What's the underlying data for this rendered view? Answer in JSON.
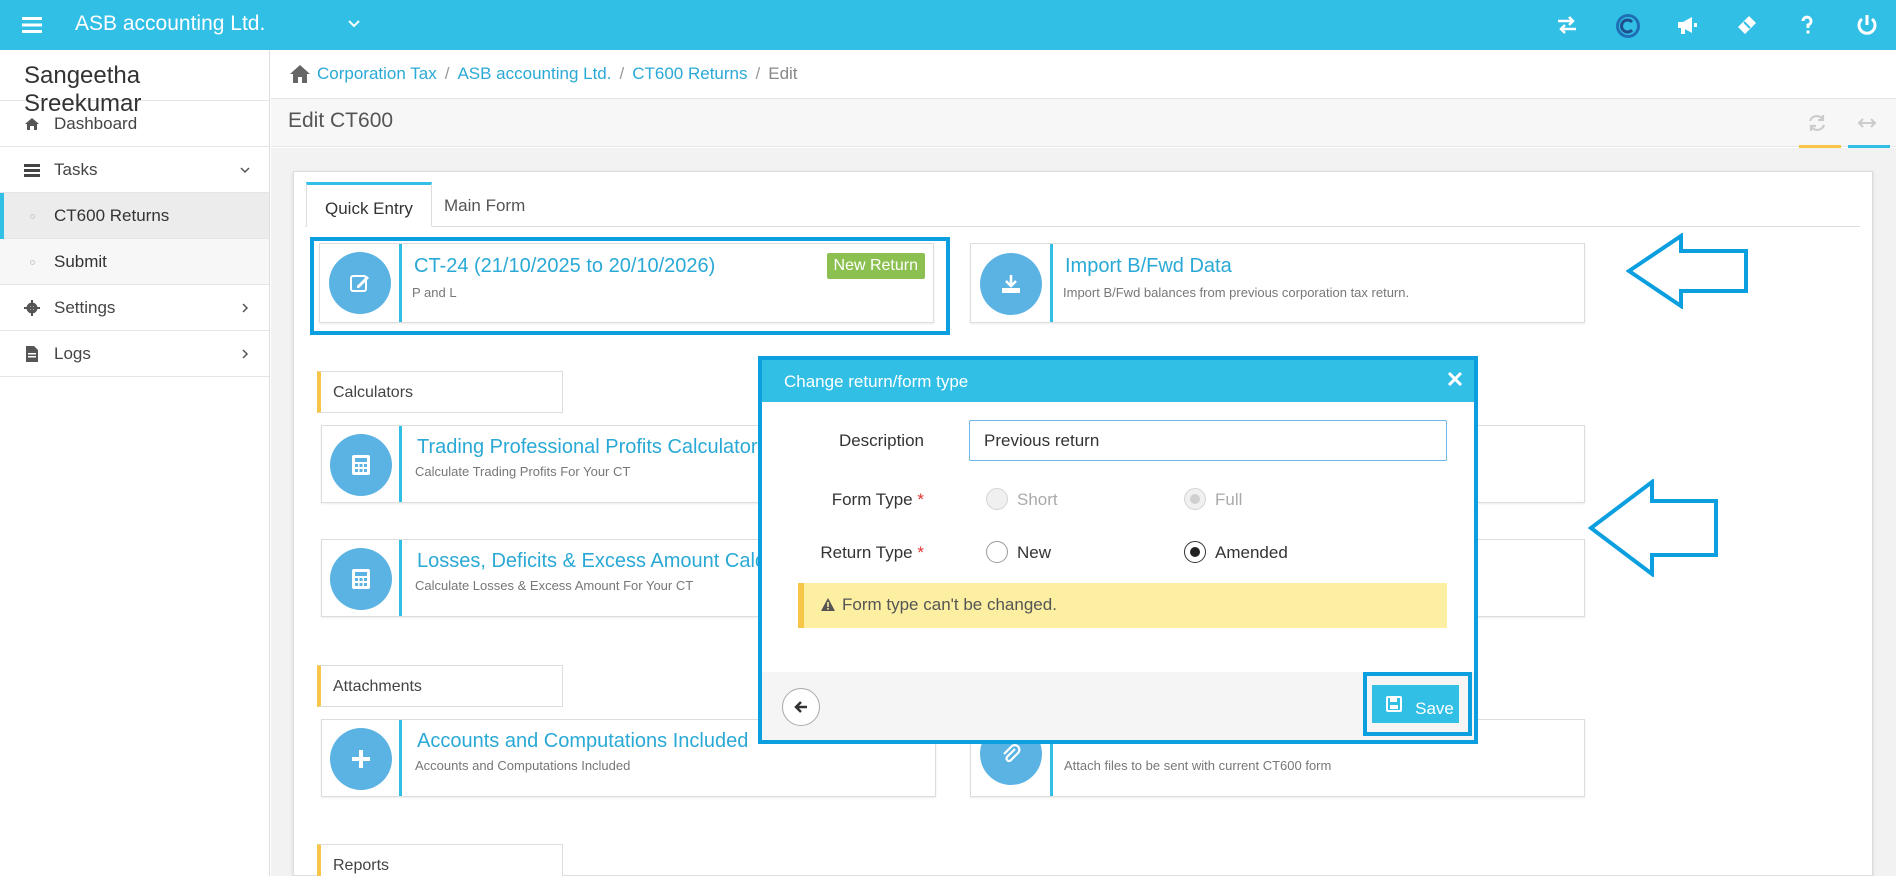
{
  "topbar": {
    "company": "ASB accounting Ltd.",
    "icons": [
      "menu-icon",
      "chevron-down-icon",
      "swap-icon",
      "c-logo-icon",
      "megaphone-icon",
      "ticket-icon",
      "question-icon",
      "power-icon"
    ]
  },
  "sidebar": {
    "user": "Sangeetha Sreekumar",
    "items": [
      {
        "label": "Dashboard",
        "icon": "home-icon"
      },
      {
        "label": "Tasks",
        "icon": "tasks-icon"
      },
      {
        "label": "CT600 Returns"
      },
      {
        "label": "Submit"
      },
      {
        "label": "Settings",
        "icon": "gear-icon"
      },
      {
        "label": "Logs",
        "icon": "file-icon"
      }
    ]
  },
  "breadcrumb": {
    "items": [
      "Corporation Tax",
      "ASB accounting Ltd.",
      "CT600 Returns"
    ],
    "current": "Edit",
    "separator": "/"
  },
  "page": {
    "title": "Edit CT600"
  },
  "tabs": [
    "Quick Entry",
    "Main Form"
  ],
  "cards": {
    "return_card": {
      "title": "CT-24 (21/10/2025 to 20/10/2026)",
      "subtitle": "P and L",
      "badge": "New Return"
    },
    "import_card": {
      "title": "Import B/Fwd Data",
      "subtitle": "Import B/Fwd balances from previous corporation tax return."
    },
    "trading": {
      "title": "Trading Professional Profits Calculator",
      "subtitle": "Calculate Trading Profits For Your CT"
    },
    "losses": {
      "title": "Losses, Deficits & Excess Amount Calculator",
      "subtitle": "Calculate Losses & Excess Amount For Your CT"
    },
    "accounts": {
      "title": "Accounts and Computations Included",
      "subtitle": "Accounts and Computations Included"
    },
    "attach": {
      "subtitle": "Attach files to be sent with current CT600 form"
    }
  },
  "sections": [
    "Calculators",
    "Attachments",
    "Reports"
  ],
  "modal": {
    "title": "Change return/form type",
    "description_label": "Description",
    "description_value": "Previous return",
    "form_type_label": "Form Type",
    "return_type_label": "Return Type",
    "required_mark": "*",
    "form_type_options": [
      "Short",
      "Full"
    ],
    "form_type_selected": "Full",
    "return_type_options": [
      "New",
      "Amended"
    ],
    "return_type_selected": "Amended",
    "warning": "Form type can't be changed.",
    "save_label": "Save"
  },
  "colors": {
    "brand": "#31bfe6",
    "highlight": "#0c9fe0",
    "badge": "#8cc152",
    "section_accent": "#f7c548"
  }
}
